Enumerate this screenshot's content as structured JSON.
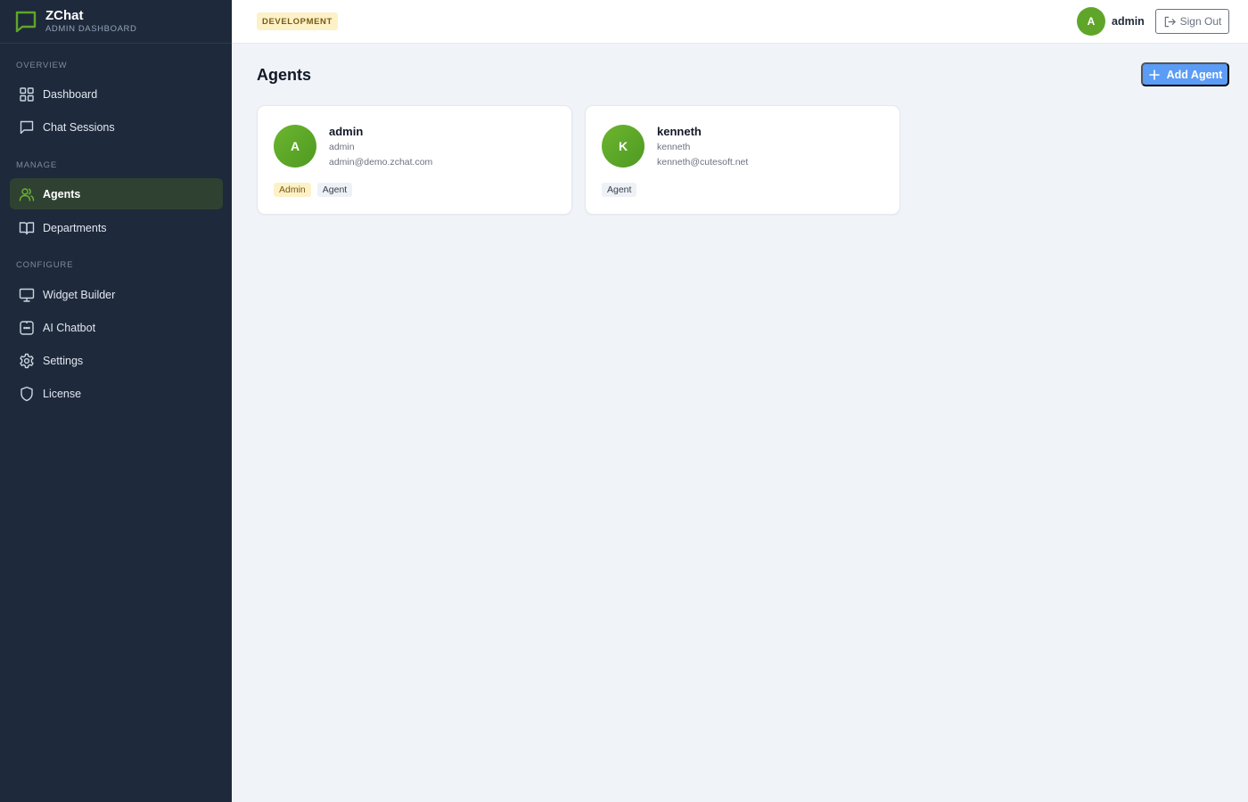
{
  "brand": {
    "name": "ZChat",
    "subtitle": "ADMIN DASHBOARD",
    "color": "#5fa52a"
  },
  "sidebar": {
    "sections": [
      {
        "label": "OVERVIEW",
        "items": [
          {
            "label": "Dashboard",
            "icon": "grid-icon",
            "active": false
          },
          {
            "label": "Chat Sessions",
            "icon": "chat-icon",
            "active": false
          }
        ]
      },
      {
        "label": "MANAGE",
        "items": [
          {
            "label": "Agents",
            "icon": "users-icon",
            "active": true
          },
          {
            "label": "Departments",
            "icon": "book-icon",
            "active": false
          }
        ]
      },
      {
        "label": "CONFIGURE",
        "items": [
          {
            "label": "Widget Builder",
            "icon": "monitor-icon",
            "active": false
          },
          {
            "label": "AI Chatbot",
            "icon": "bot-icon",
            "active": false
          },
          {
            "label": "Settings",
            "icon": "gear-icon",
            "active": false
          },
          {
            "label": "License",
            "icon": "shield-icon",
            "active": false
          }
        ]
      }
    ]
  },
  "header": {
    "environment": "DEVELOPMENT",
    "user": {
      "initial": "A",
      "name": "admin"
    },
    "signout_label": "Sign Out"
  },
  "main": {
    "title": "Agents",
    "add_button_label": "Add Agent",
    "agents": [
      {
        "initial": "A",
        "name": "admin",
        "username": "admin",
        "email": "admin@demo.zchat.com",
        "tags": [
          "Admin",
          "Agent"
        ]
      },
      {
        "initial": "K",
        "name": "kenneth",
        "username": "kenneth",
        "email": "kenneth@cutesoft.net",
        "tags": [
          "Agent"
        ]
      }
    ]
  },
  "colors": {
    "sidebar_bg": "#1e293b",
    "active_bg": "#2f4232",
    "accent_green": "#5fa52a",
    "primary_blue": "#5b9cf6",
    "page_bg": "#f0f4f8"
  }
}
